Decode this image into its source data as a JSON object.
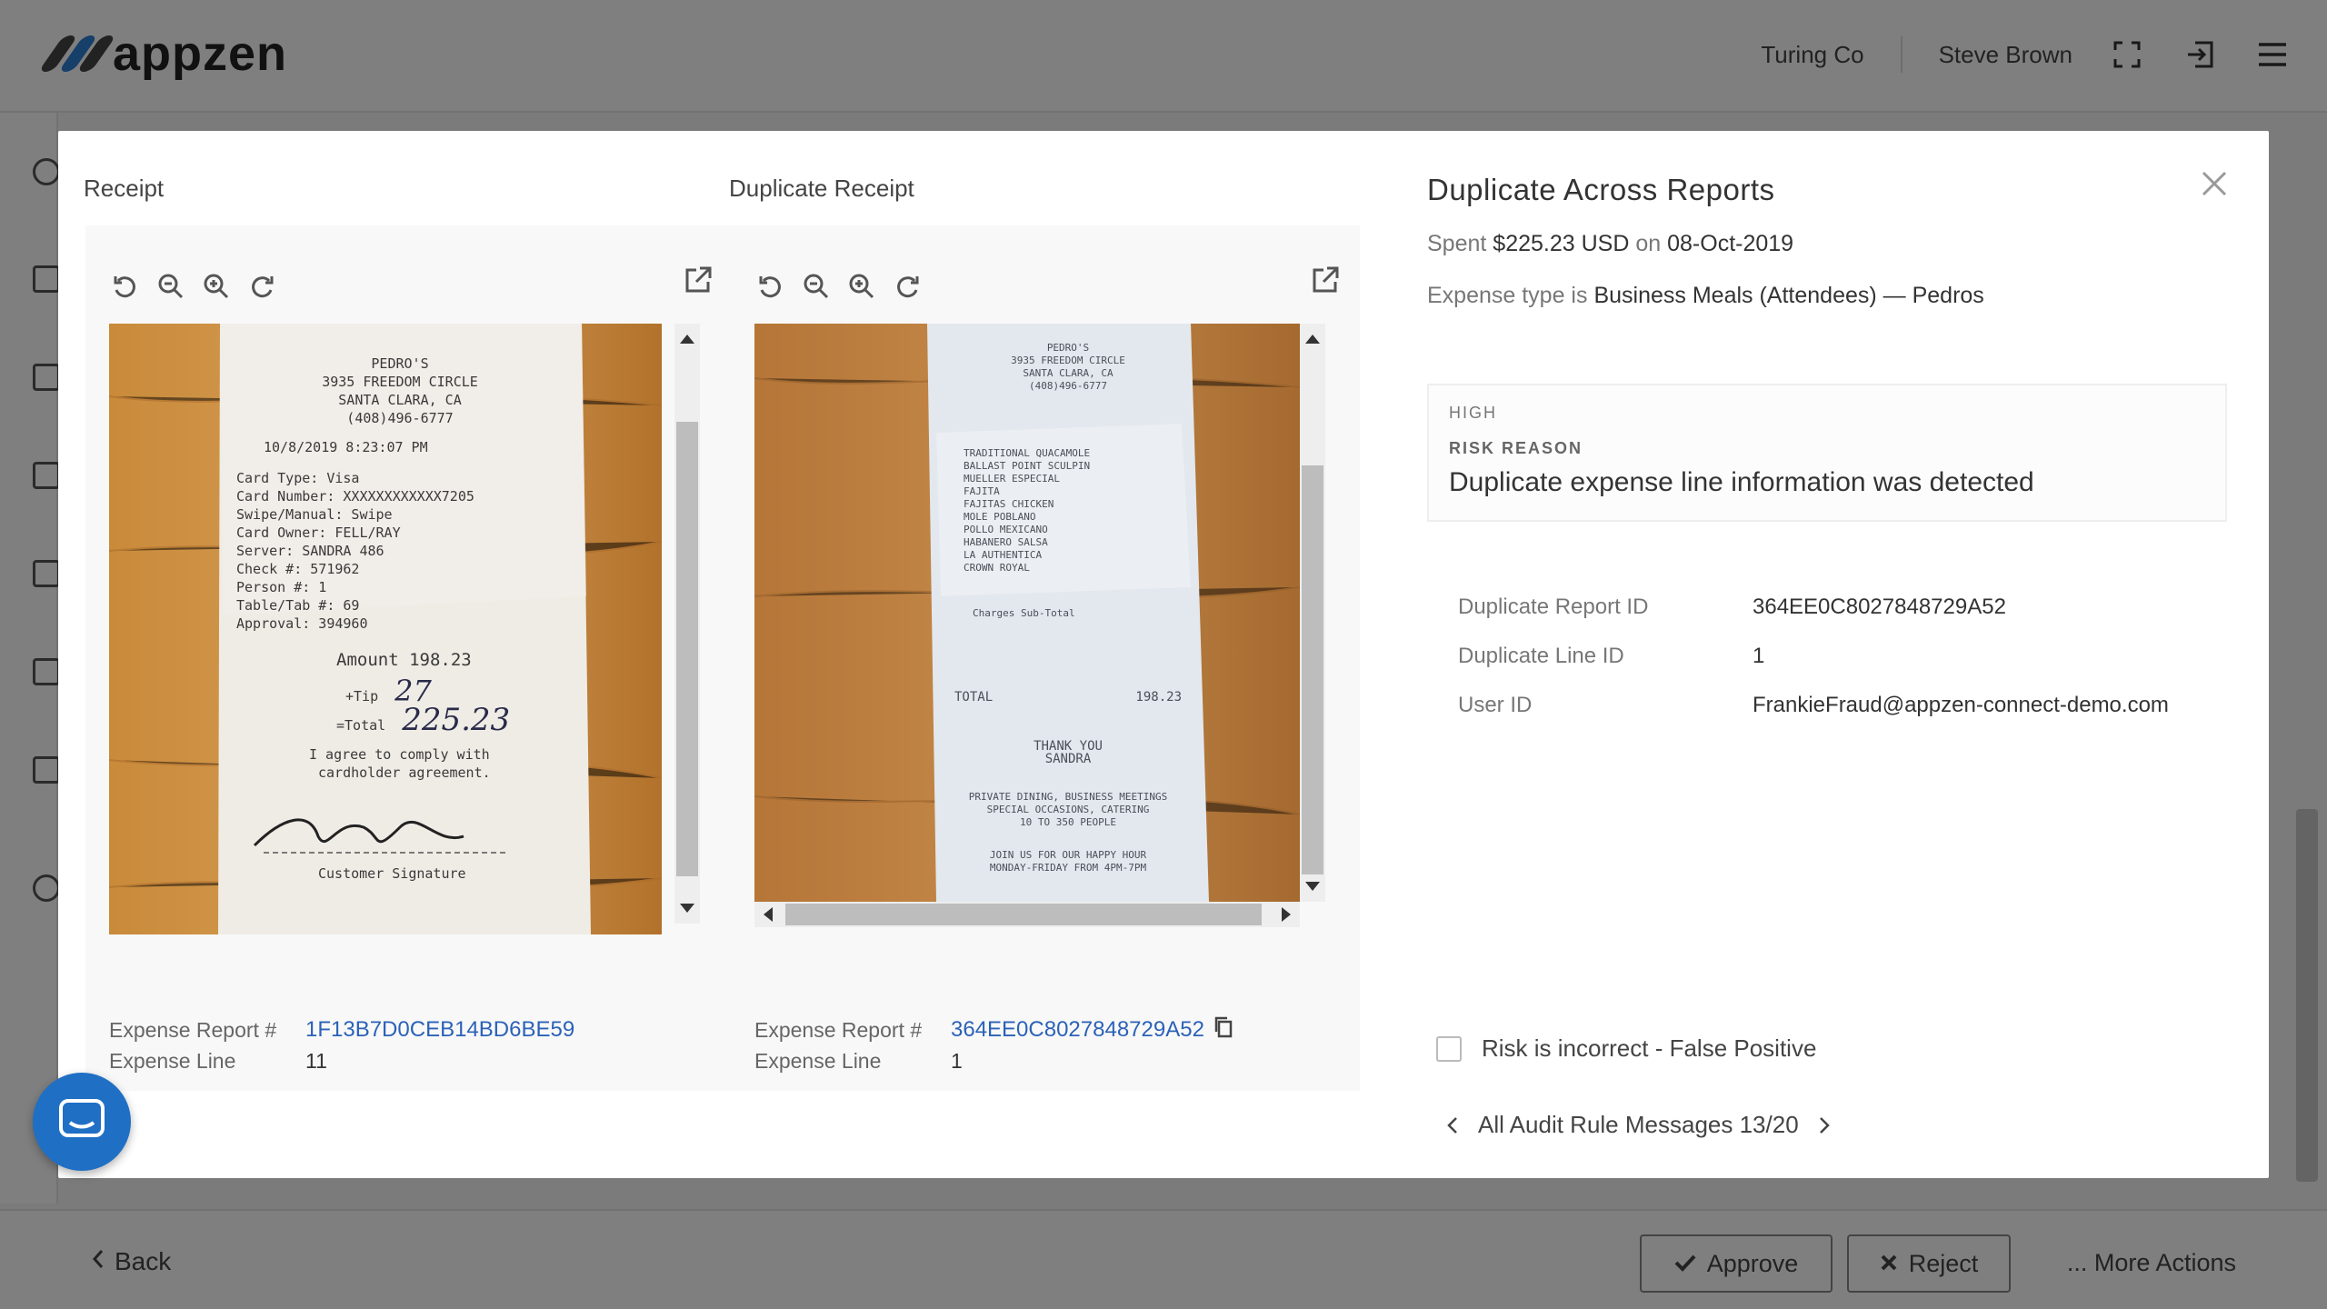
{
  "app": {
    "brand": "appzen",
    "org": "Turing Co",
    "user": "Steve Brown",
    "colors": {
      "accent": "#2b62b8",
      "logo_gray": "#444444",
      "logo_blue": "#2d7fd3",
      "chat": "#1f6fc5"
    }
  },
  "footer": {
    "back_label": "Back",
    "approve_label": "Approve",
    "reject_label": "Reject",
    "more_label": "... More Actions"
  },
  "modal": {
    "receipt": {
      "label": "Receipt",
      "report_label": "Expense Report #",
      "report_value": "1F13B7D0CEB14BD6BE59",
      "line_label": "Expense Line",
      "line_value": "11"
    },
    "duplicate": {
      "label": "Duplicate Receipt",
      "report_label": "Expense Report #",
      "report_value": "364EE0C8027848729A52",
      "line_label": "Expense Line",
      "line_value": "1"
    },
    "details": {
      "title": "Duplicate Across Reports",
      "spent_prefix": "Spent",
      "spent_amount": "$225.23 USD",
      "spent_on": "on",
      "spent_date": "08-Oct-2019",
      "type_prefix": "Expense type is",
      "type_value": "Business Meals (Attendees) — Pedros",
      "risk_severity": "HIGH",
      "risk_label": "RISK REASON",
      "risk_text": "Duplicate expense line information was detected",
      "fields": [
        {
          "k": "Duplicate Report ID",
          "v": "364EE0C8027848729A52"
        },
        {
          "k": "Duplicate Line ID",
          "v": "1"
        },
        {
          "k": "User ID",
          "v": "FrankieFraud@appzen-connect-demo.com"
        }
      ],
      "false_positive_label": "Risk is incorrect - False Positive",
      "pager_label": "All Audit Rule Messages 13/20"
    },
    "receipt_image": {
      "lines": [
        "PEDRO'S",
        "3935 FREEDOM CIRCLE",
        "SANTA CLARA, CA",
        "(408)496-6777",
        "10/8/2019    8:23:07 PM",
        "Card Type:      Visa",
        "Card Number:  XXXXXXXXXXXX7205",
        "Swipe/Manual:  Swipe",
        "Card Owner:    FELL/RAY",
        "Server:       SANDRA  486",
        "Check #:      571962",
        "Person #:     1",
        "Table/Tab #:  69",
        "Approval:     394960"
      ],
      "amount": "Amount 198.23",
      "tip": "+Tip",
      "tip_hand": "27",
      "total": "=Total",
      "total_hand": "225.23",
      "agree": "I agree to comply with",
      "agree2": "cardholder agreement.",
      "sig": "Customer Signature"
    },
    "dup_image": {
      "header": [
        "PEDRO'S",
        "3935 FREEDOM CIRCLE",
        "SANTA CLARA, CA",
        "(408)496-6777"
      ],
      "items": [
        "TRADITIONAL QUACAMOLE",
        "BALLAST POINT SCULPIN",
        "MUELLER ESPECIAL",
        "FAJITA",
        "FAJITAS CHICKEN",
        "MOLE POBLANO",
        "POLLO MEXICANO",
        "HABANERO SALSA",
        "LA AUTHENTICA",
        "CROWN ROYAL"
      ],
      "subtotal": "Charges Sub-Total",
      "total_label": "TOTAL",
      "total_value": "198.23",
      "thanks": "THANK YOU",
      "server": "SANDRA",
      "footer1": "PRIVATE DINING, BUSINESS MEETINGS",
      "footer2": "SPECIAL OCCASIONS, CATERING",
      "footer3": "10 TO 350 PEOPLE",
      "footer4": "JOIN US FOR OUR HAPPY HOUR",
      "footer5": "MONDAY-FRIDAY FROM 4PM-7PM"
    }
  }
}
